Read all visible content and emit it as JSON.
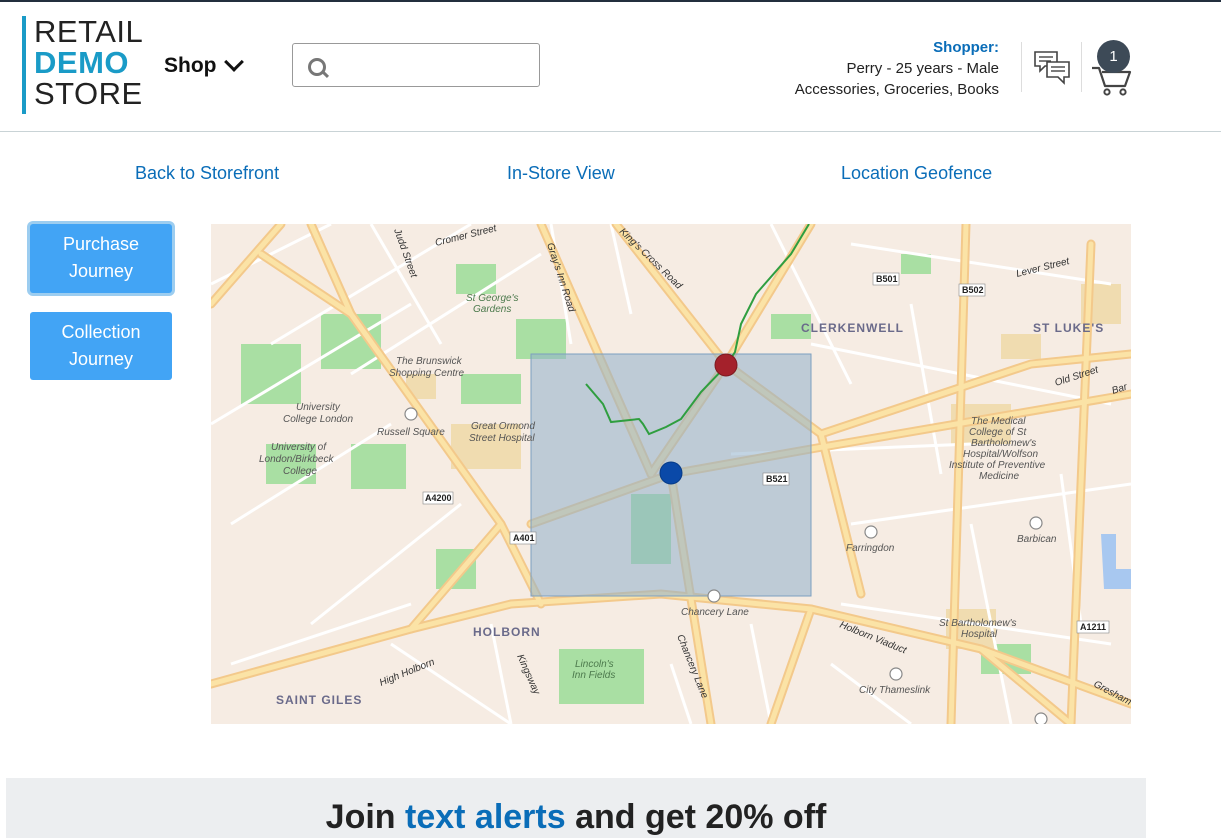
{
  "logo": {
    "line1": "RETAIL",
    "line2": "DEMO",
    "line3": "STORE"
  },
  "header": {
    "shop_label": "Shop",
    "search_placeholder": "",
    "shopper_label": "Shopper:",
    "shopper_line1": "Perry - 25 years - Male",
    "shopper_line2": "Accessories, Groceries, Books",
    "cart_count": "1"
  },
  "nav": {
    "back": "Back to Storefront",
    "instore": "In-Store View",
    "geofence": "Location Geofence"
  },
  "journeys": [
    {
      "line1": "Purchase",
      "line2": "Journey",
      "active": true
    },
    {
      "line1": "Collection",
      "line2": "Journey",
      "active": false
    }
  ],
  "map": {
    "areas": [
      "CLERKENWELL",
      "ST LUKE'S",
      "HOLBORN",
      "SAINT GILES"
    ],
    "places": {
      "st_georges": [
        "St George's",
        "Gardens"
      ],
      "brunswick": [
        "The Brunswick",
        "Shopping Centre"
      ],
      "ucl": [
        "University",
        "College London"
      ],
      "birkbeck": [
        "University of",
        "London/Birkbeck",
        "College"
      ],
      "ormond": [
        "Great Ormond",
        "Street Hospital"
      ],
      "medical": [
        "The Medical",
        "College of St",
        "Bartholomew's",
        "Hospital/Wolfson",
        "Institute of Preventive",
        "Medicine"
      ],
      "barts": [
        "St Bartholomew's",
        "Hospital"
      ],
      "lincolns": [
        "Lincoln's",
        "Inn Fields"
      ]
    },
    "stations": [
      "Russell Square",
      "Farringdon",
      "Barbican",
      "Chancery Lane",
      "City Thameslink"
    ],
    "roads": [
      "Cromer Street",
      "Judd Street",
      "Gray's Inn Road",
      "King's Cross Road",
      "Lever Street",
      "Old Street",
      "Bar",
      "High Holborn",
      "Kingsway",
      "Chancery Lane",
      "Holborn Viaduct",
      "Gresham"
    ],
    "shields": [
      "B501",
      "B502",
      "A4200",
      "A401",
      "B521",
      "A1211"
    ]
  },
  "banner": {
    "pre": "Join ",
    "link": "text alerts",
    "post": " and get 20% off"
  }
}
